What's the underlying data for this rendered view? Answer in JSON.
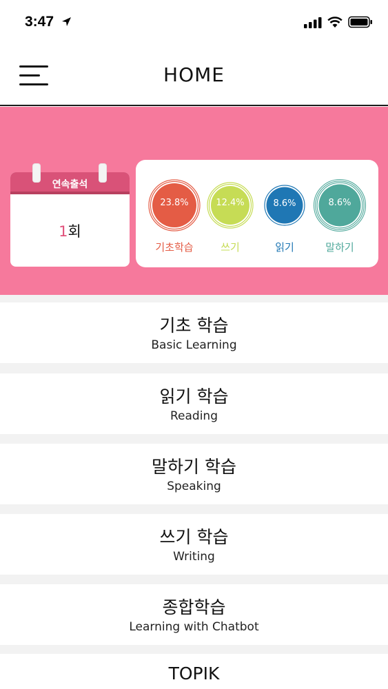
{
  "status_bar": {
    "time": "3:47",
    "icons": [
      "location-arrow-icon",
      "signal-icon",
      "wifi-icon",
      "battery-icon"
    ]
  },
  "nav": {
    "title": "HOME",
    "menu_icon": "hamburger-menu-icon"
  },
  "attendance": {
    "label": "연속출석",
    "count": "1",
    "unit": "회"
  },
  "progress": [
    {
      "value": "23.8%",
      "label": "기초학습",
      "color": "#e45c45",
      "label_color": "#e45c45"
    },
    {
      "value": "12.4%",
      "label": "쓰기",
      "color": "#c6dc55",
      "label_color": "#c6dc55"
    },
    {
      "value": "8.6%",
      "label": "읽기",
      "color": "#1f77b4",
      "label_color": "#1f77b4"
    },
    {
      "value": "8.6%",
      "label": "말하기",
      "color": "#4fa89b",
      "label_color": "#4fa89b"
    }
  ],
  "menu": [
    {
      "title": "기초 학습",
      "subtitle": "Basic Learning"
    },
    {
      "title": "읽기 학습",
      "subtitle": "Reading"
    },
    {
      "title": "말하기 학습",
      "subtitle": "Speaking"
    },
    {
      "title": "쓰기 학습",
      "subtitle": "Writing"
    },
    {
      "title": "종합학습",
      "subtitle": "Learning with Chatbot"
    },
    {
      "title": "TOPIK",
      "subtitle": ""
    }
  ],
  "colors": {
    "banner_pink": "#f6799c",
    "calendar_header": "#d95278"
  }
}
